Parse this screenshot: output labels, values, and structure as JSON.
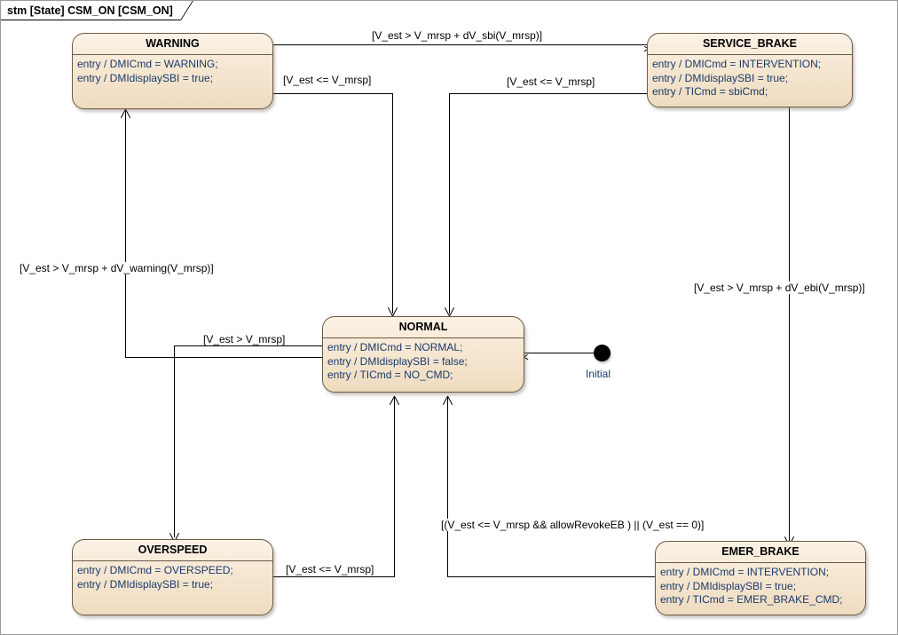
{
  "frame": {
    "title": "stm [State] CSM_ON [CSM_ON]"
  },
  "colors": {
    "state_fill": "#f6e7d2",
    "state_border": "#6b5a44",
    "entry_text": "#1a3a6b",
    "connector": "#000000",
    "background": "#ffffff"
  },
  "states": {
    "warning": {
      "name": "WARNING",
      "entries": [
        "entry / DMICmd = WARNING;",
        "entry / DMIdisplaySBI = true;"
      ]
    },
    "service_brake": {
      "name": "SERVICE_BRAKE",
      "entries": [
        "entry / DMICmd = INTERVENTION;",
        "entry / DMIdisplaySBI = true;",
        "entry / TICmd = sbiCmd;"
      ]
    },
    "normal": {
      "name": "NORMAL",
      "entries": [
        "entry / DMICmd = NORMAL;",
        "entry / DMIdisplaySBI = false;",
        "entry / TICmd = NO_CMD;"
      ]
    },
    "overspeed": {
      "name": "OVERSPEED",
      "entries": [
        "entry / DMICmd = OVERSPEED;",
        "entry / DMIdisplaySBI = true;"
      ]
    },
    "emer_brake": {
      "name": "EMER_BRAKE",
      "entries": [
        "entry / DMICmd = INTERVENTION;",
        "entry / DMIdisplaySBI = true;",
        "entry / TICmd = EMER_BRAKE_CMD;"
      ]
    }
  },
  "initial": {
    "label": "Initial",
    "icon": "filled-circle-icon"
  },
  "transitions": {
    "warning_to_service_brake": "[V_est > V_mrsp + dV_sbi(V_mrsp)]",
    "warning_to_normal": "[V_est <= V_mrsp]",
    "service_brake_to_normal": "[V_est <= V_mrsp]",
    "normal_to_warning": "[V_est > V_mrsp + dV_warning(V_mrsp)]",
    "overspeed_to_normal_top": "[V_est > V_mrsp]",
    "service_brake_to_emer_brake": "[V_est > V_mrsp + dV_ebi(V_mrsp)]",
    "overspeed_to_normal_bottom": "[V_est <= V_mrsp]",
    "emer_brake_to_normal": "[(V_est <= V_mrsp && allowRevokeEB ) || (V_est == 0)]"
  }
}
